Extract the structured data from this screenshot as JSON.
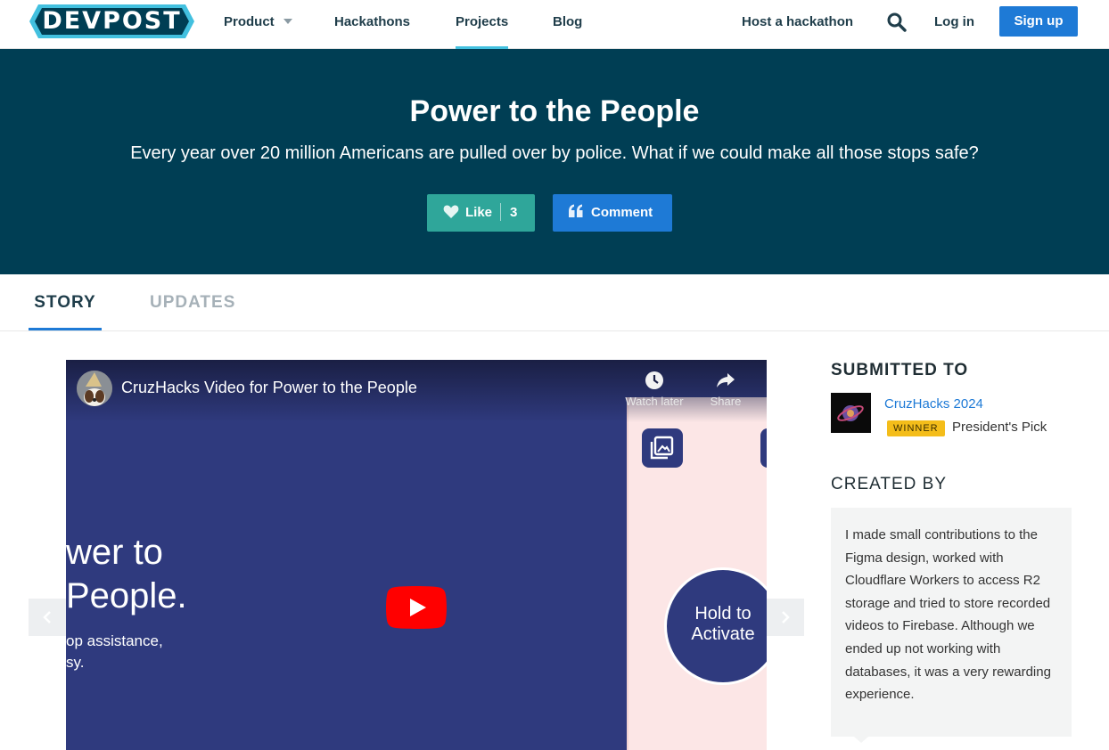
{
  "brand": {
    "logo_text": "DEVPOST",
    "color": "#003e54",
    "accent": "#42c0df"
  },
  "nav": {
    "product": "Product",
    "hackathons": "Hackathons",
    "projects": "Projects",
    "blog": "Blog",
    "host": "Host a hackathon",
    "search_icon": "search-icon",
    "login": "Log in",
    "signup": "Sign up"
  },
  "hero": {
    "title": "Power to the People",
    "tagline": "Every year over 20 million Americans are pulled over by police. What if we could make all those stops safe?",
    "like_label": "Like",
    "like_count": "3",
    "comment_label": "Comment"
  },
  "tabs": {
    "story": "STORY",
    "updates": "UPDATES"
  },
  "video": {
    "title": "CruzHacks Video for Power to the People",
    "watch_later": "Watch later",
    "share": "Share",
    "frame_line1": "wer to",
    "frame_line2": "People.",
    "frame_small1": "op assistance,",
    "frame_small2": "sy.",
    "hold_line1": "Hold to",
    "hold_line2": "Activate"
  },
  "sidebar": {
    "submitted_heading": "SUBMITTED TO",
    "hackathon": "CruzHacks 2024",
    "badge": "WINNER",
    "prize": "President's Pick",
    "created_heading": "CREATED BY",
    "contribution": "I made small contributions to the Figma design, worked with Cloudflare Workers to access R2 storage and tried to store recorded videos to Firebase. Although we ended up not working with databases, it was a very rewarding experience."
  }
}
